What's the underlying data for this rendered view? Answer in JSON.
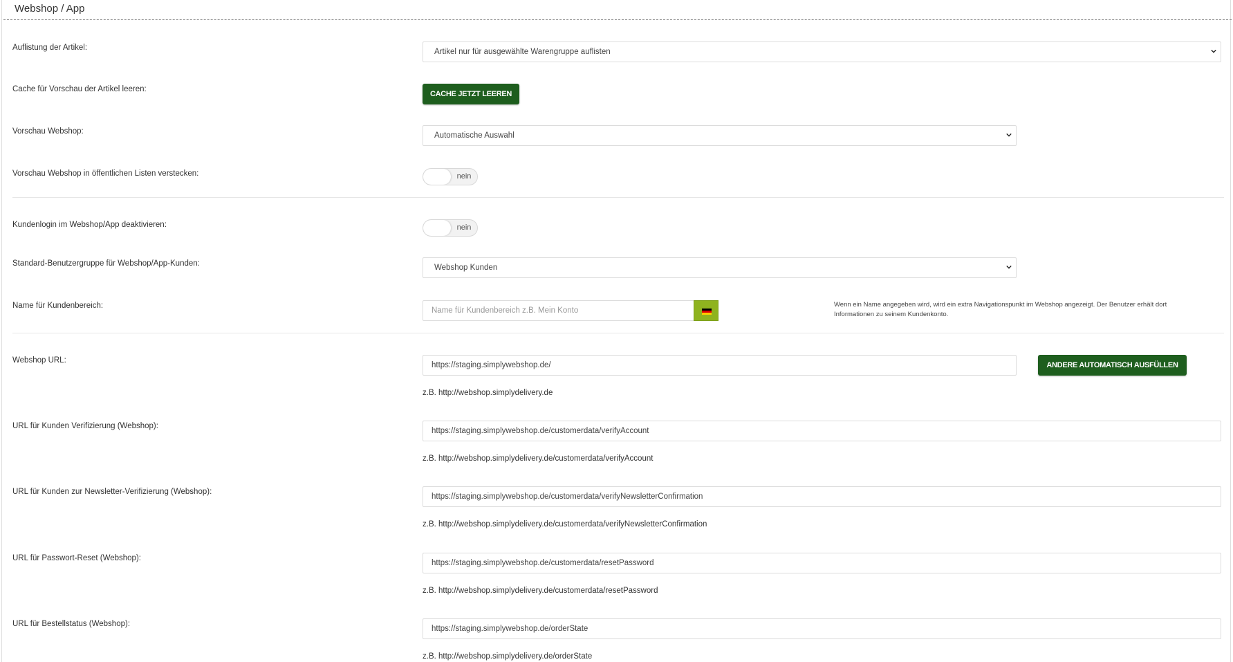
{
  "panel": {
    "title": "Webshop / App"
  },
  "rows": {
    "artikel": {
      "label": "Auflistung der Artikel:",
      "value": "Artikel nur für ausgewählte Warengruppe auflisten"
    },
    "cache": {
      "label": "Cache für Vorschau der Artikel leeren:",
      "button": "CACHE JETZT LEEREN"
    },
    "vorschau": {
      "label": "Vorschau Webshop:",
      "value": "Automatische Auswahl"
    },
    "verstecken": {
      "label": "Vorschau Webshop in öffentlichen Listen verstecken:",
      "state": "nein"
    },
    "kundenlogin": {
      "label": "Kundenlogin im Webshop/App deaktivieren:",
      "state": "nein"
    },
    "benutzergruppe": {
      "label": "Standard-Benutzergruppe für Webshop/App-Kunden:",
      "value": "Webshop Kunden"
    },
    "kundenbereich": {
      "label": "Name für Kundenbereich:",
      "placeholder": "Name für Kundenbereich z.B. Mein Konto",
      "flag_icon": "germany-flag-icon",
      "help": "Wenn ein Name angegeben wird, wird ein extra Navigationspunkt im Webshop angezeigt. Der Benutzer erhält dort Informationen zu seinem Kundenkonto."
    },
    "webshop_url": {
      "label": "Webshop URL:",
      "value": "https://staging.simplywebshop.de/",
      "button": "ANDERE AUTOMATISCH AUSFÜLLEN",
      "hint": "z.B. http://webshop.simplydelivery.de"
    },
    "verifizierung": {
      "label": "URL für Kunden Verifizierung (Webshop):",
      "value": "https://staging.simplywebshop.de/customerdata/verifyAccount",
      "hint": "z.B. http://webshop.simplydelivery.de/customerdata/verifyAccount"
    },
    "newsletter": {
      "label": "URL für Kunden zur Newsletter-Verifizierung (Webshop):",
      "value": "https://staging.simplywebshop.de/customerdata/verifyNewsletterConfirmation",
      "hint": "z.B. http://webshop.simplydelivery.de/customerdata/verifyNewsletterConfirmation"
    },
    "passwort": {
      "label": "URL für Passwort-Reset (Webshop):",
      "value": "https://staging.simplywebshop.de/customerdata/resetPassword",
      "hint": "z.B. http://webshop.simplydelivery.de/customerdata/resetPassword"
    },
    "bestellstatus": {
      "label": "URL für Bestellstatus (Webshop):",
      "value": "https://staging.simplywebshop.de/orderState",
      "hint": "z.B. http://webshop.simplydelivery.de/orderState"
    }
  },
  "colors": {
    "button_green": "#1e5e1e",
    "flag_button_green": "#8fb31f"
  }
}
